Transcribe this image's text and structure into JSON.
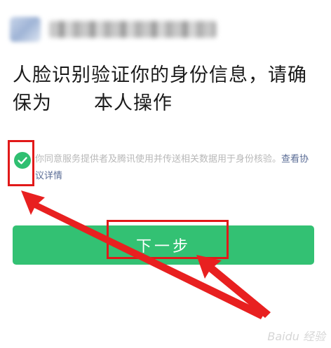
{
  "header": {
    "avatar_blurred": true,
    "name_blurred": true
  },
  "title": {
    "line1": "人脸识别验证你的身份信息，请确",
    "line2_prefix": "保为",
    "line2_suffix": "本人操作"
  },
  "agreement": {
    "checked": true,
    "text": "你同意服务提供者及腾讯使用并传送相关数据用于身份核验。",
    "link_text": "查看协议详情"
  },
  "next_button": {
    "label": "下一步"
  },
  "annotations": {
    "color": "#e11919"
  },
  "watermark": "Baidu 经验",
  "colors": {
    "accent_green": "#33c173",
    "check_green": "#2fbf71",
    "link_blue": "#5b6d96"
  }
}
